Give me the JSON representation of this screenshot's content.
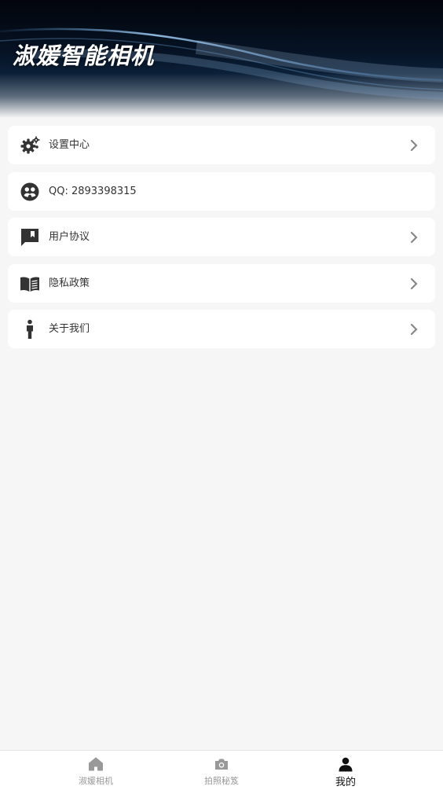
{
  "banner": {
    "title": "淑媛智能相机"
  },
  "menu": {
    "items": [
      {
        "label": "设置中心",
        "icon": "settings-gear-icon",
        "has_arrow": true
      },
      {
        "label": "QQ: 2893398315",
        "icon": "qq-community-icon",
        "has_arrow": false
      },
      {
        "label": "用户协议",
        "icon": "bookmark-chat-icon",
        "has_arrow": true
      },
      {
        "label": "隐私政策",
        "icon": "open-book-icon",
        "has_arrow": true
      },
      {
        "label": "关于我们",
        "icon": "person-standing-icon",
        "has_arrow": true
      }
    ]
  },
  "tabbar": {
    "tabs": [
      {
        "label": "淑媛相机",
        "icon": "home-icon",
        "active": false
      },
      {
        "label": "拍照秘笈",
        "icon": "camera-icon",
        "active": false
      },
      {
        "label": "我的",
        "icon": "user-icon",
        "active": true
      }
    ]
  },
  "colors": {
    "background": "#f6f6f6",
    "card": "#ffffff",
    "icon": "#333333",
    "tab_inactive": "#999999",
    "tab_active": "#111111"
  }
}
